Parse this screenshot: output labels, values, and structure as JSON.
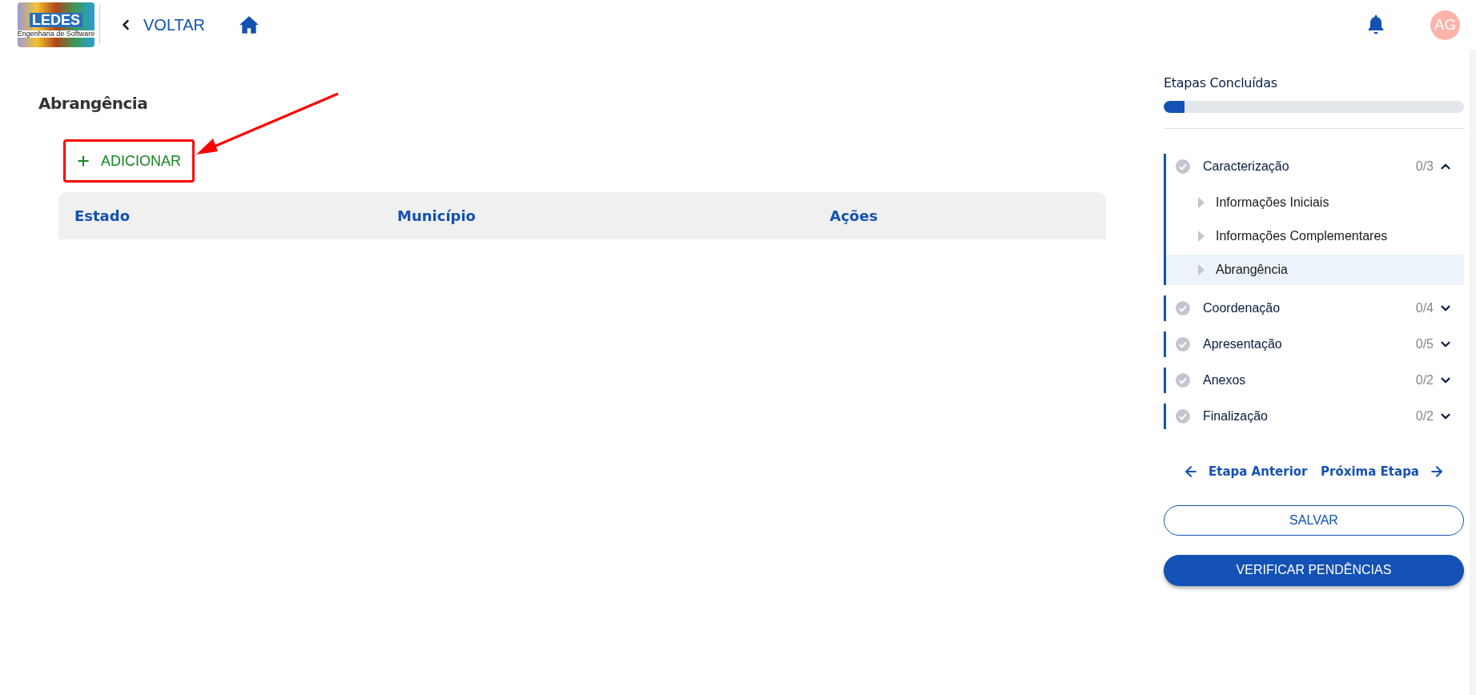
{
  "header": {
    "logo": {
      "title": "LEDES",
      "subtitle": "Engenharia de Software"
    },
    "back_label": "VOLTAR",
    "avatar_initials": "AG"
  },
  "content": {
    "title": "Abrangência",
    "add_button": "ADICIONAR",
    "table": {
      "columns": [
        "Estado",
        "Município",
        "Ações"
      ]
    }
  },
  "sidebar": {
    "progress_title": "Etapas Concluídas",
    "progress": {
      "level": 0.07
    },
    "sections": [
      {
        "label": "Caracterização",
        "count": "0/3",
        "expanded": true,
        "children": [
          {
            "label": "Informações Iniciais",
            "selected": false
          },
          {
            "label": "Informações Complementares",
            "selected": false
          },
          {
            "label": "Abrangência",
            "selected": true
          }
        ]
      },
      {
        "label": "Coordenação",
        "count": "0/4",
        "expanded": false
      },
      {
        "label": "Apresentação",
        "count": "0/5",
        "expanded": false
      },
      {
        "label": "Anexos",
        "count": "0/2",
        "expanded": false
      },
      {
        "label": "Finalização",
        "count": "0/2",
        "expanded": false
      }
    ],
    "prev_label": "Etapa Anterior",
    "next_label": "Próxima Etapa",
    "save_button": "SALVAR",
    "verify_button": "VERIFICAR PENDÊNCIAS"
  }
}
